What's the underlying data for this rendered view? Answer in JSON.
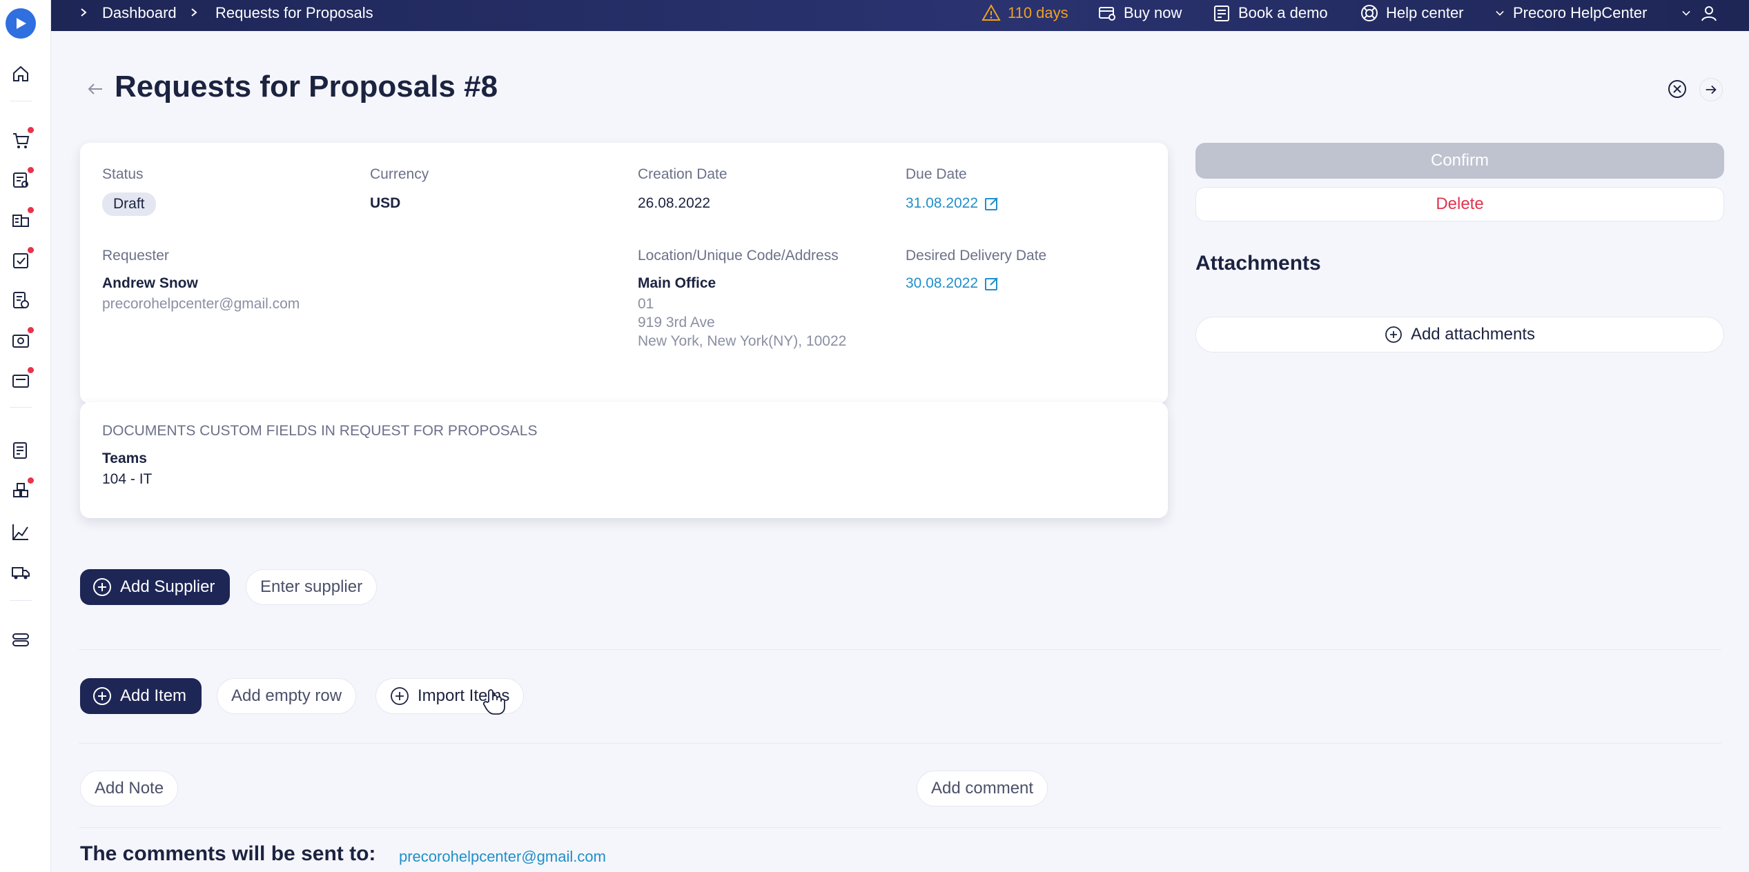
{
  "breadcrumb": {
    "items": [
      "Dashboard",
      "Requests for Proposals"
    ]
  },
  "topbar": {
    "trial": "110 days",
    "buy_now": "Buy now",
    "book_demo": "Book a demo",
    "help_center": "Help center",
    "account": "Precoro HelpCenter"
  },
  "page": {
    "title": "Requests for Proposals #8"
  },
  "details": {
    "status_label": "Status",
    "status_value": "Draft",
    "currency_label": "Currency",
    "currency_value": "USD",
    "creation_label": "Creation Date",
    "creation_value": "26.08.2022",
    "due_label": "Due Date",
    "due_value": "31.08.2022",
    "requester_label": "Requester",
    "requester_name": "Andrew Snow",
    "requester_email": "precorohelpcenter@gmail.com",
    "location_label": "Location/Unique Code/Address",
    "location_name": "Main Office",
    "location_code": "01",
    "location_street": "919 3rd Ave",
    "location_city": "New York, New York(NY), 10022",
    "delivery_label": "Desired Delivery Date",
    "delivery_value": "30.08.2022"
  },
  "custom_fields": {
    "heading": "DOCUMENTS CUSTOM FIELDS IN REQUEST FOR PROPOSALS",
    "field_label": "Teams",
    "field_value": "104 - IT"
  },
  "actions": {
    "confirm": "Confirm",
    "delete": "Delete",
    "attachments_title": "Attachments",
    "add_attachments": "Add attachments"
  },
  "supplier": {
    "add_label": "Add Supplier",
    "enter_label": "Enter supplier"
  },
  "items": {
    "add_label": "Add Item",
    "empty_row_label": "Add empty row",
    "import_label": "Import Items"
  },
  "notes": {
    "add_note": "Add Note",
    "add_comment": "Add comment"
  },
  "comments": {
    "recipients_label": "The comments will be sent to:",
    "recipient_email": "precorohelpcenter@gmail.com"
  },
  "colors": {
    "navy": "#1e2656",
    "link": "#1f8fc9",
    "danger": "#e0344f",
    "warning": "#f0a020"
  }
}
